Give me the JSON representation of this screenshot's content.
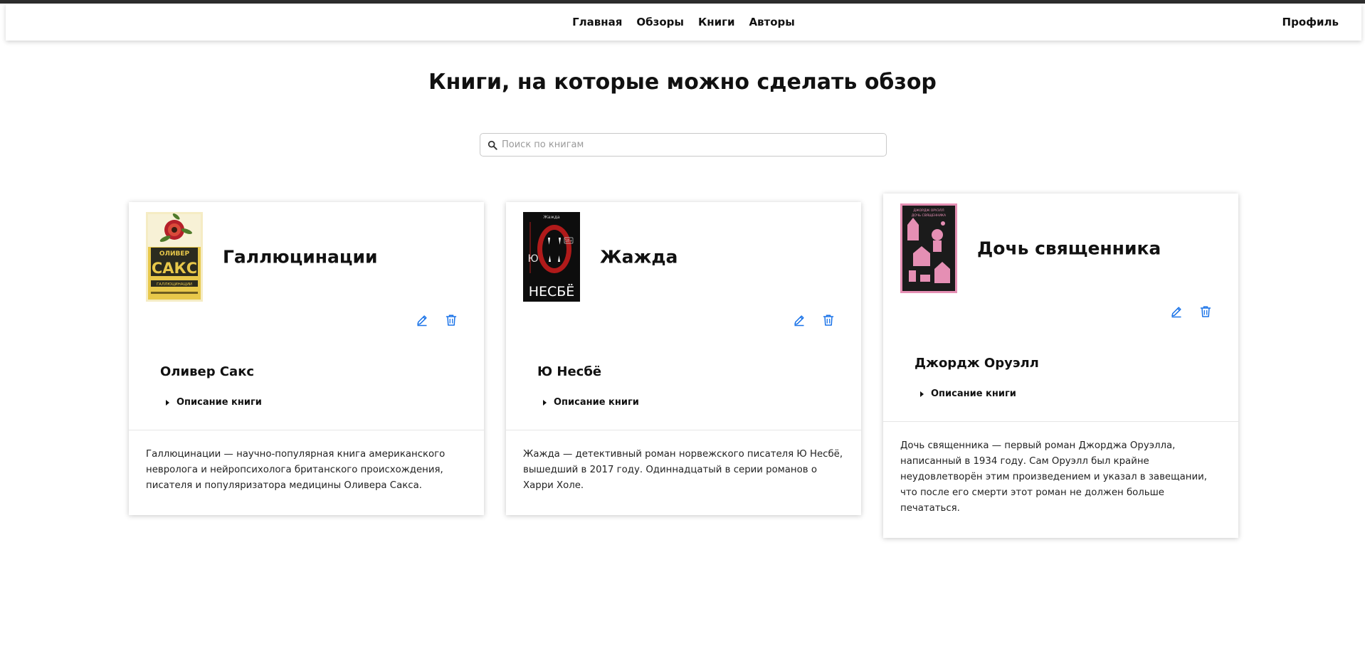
{
  "nav": {
    "links": [
      "Главная",
      "Обзоры",
      "Книги",
      "Авторы"
    ],
    "profile": "Профиль"
  },
  "page": {
    "title": "Книги, на которые можно сделать обзор"
  },
  "search": {
    "placeholder": "Поиск по книгам",
    "icon": "search-icon"
  },
  "colors": {
    "accent": "#1a73e8",
    "text": "#111111"
  },
  "books": [
    {
      "title": "Галлюцинации",
      "author": "Оливер Сакс",
      "toggle_label": "Описание книги",
      "description": "Галлюцинации — научно-популярная книга американского невролога и нейропсихолога британского происхождения, писателя и популяризатора медицины Оливера Сакса.",
      "cover": {
        "author_line": "ОЛИВЕР",
        "title_line": "САКС",
        "sub": "ГАЛЛЮЦИНАЦИИ"
      }
    },
    {
      "title": "Жажда",
      "author": "Ю Несбё",
      "toggle_label": "Описание книги",
      "description": "Жажда — детективный роман норвежского писателя Ю Несбё, вышедший в 2017 году. Одиннадцатый в серии романов о Харри Холе.",
      "cover": {
        "top": "Жажда",
        "letter": "Ю",
        "bottom": "НЕСБЁ",
        "age": "18+"
      }
    },
    {
      "title": "Дочь священника",
      "author": "Джордж Оруэлл",
      "toggle_label": "Описание книги",
      "description": "Дочь священника — первый роман Джорджа Оруэлла, написанный в 1934 году. Сам Оруэлл был крайне неудовлетворён этим произведением и указал в завещании, что после его смерти этот роман не должен больше печататься.",
      "cover": {
        "top": "ДЖОРДЖ ОРУЭЛЛ",
        "title": "ДОЧЬ СВЯЩЕННИКА"
      }
    }
  ]
}
